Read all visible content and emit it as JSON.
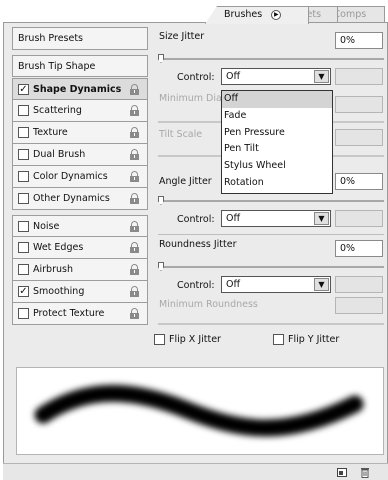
{
  "tabs": [
    {
      "label": "Brushes",
      "active": true
    },
    {
      "label": "Tool Presets",
      "active": false
    },
    {
      "label": "Layer Comps",
      "active": false
    }
  ],
  "tab_menu_icon": "circle-arrow-icon",
  "sidebar": {
    "brush_presets": "Brush Presets",
    "brush_tip_shape": "Brush Tip Shape",
    "items": [
      {
        "label": "Shape Dynamics",
        "checked": true,
        "selected": true
      },
      {
        "label": "Scattering",
        "checked": false
      },
      {
        "label": "Texture",
        "checked": false
      },
      {
        "label": "Dual Brush",
        "checked": false
      },
      {
        "label": "Color Dynamics",
        "checked": false
      },
      {
        "label": "Other Dynamics",
        "checked": false
      },
      {
        "label": "Noise",
        "checked": false
      },
      {
        "label": "Wet Edges",
        "checked": false
      },
      {
        "label": "Airbrush",
        "checked": false
      },
      {
        "label": "Smoothing",
        "checked": true
      },
      {
        "label": "Protect Texture",
        "checked": false
      }
    ],
    "check_mark": "✓",
    "lock_icon": "lock-icon"
  },
  "settings": {
    "size_jitter": {
      "label": "Size Jitter",
      "value": "0%",
      "slider_fraction": 0
    },
    "size_control": {
      "label": "Control:",
      "value": "Off"
    },
    "minimum_diameter": {
      "label": "Minimum Diameter",
      "visible_part": "Minimum Dia"
    },
    "tilt_scale": {
      "label": "Tilt Scale"
    },
    "angle_jitter": {
      "label": "Angle Jitter",
      "value": "0%",
      "slider_fraction": 0
    },
    "angle_control": {
      "label": "Control:",
      "value": "Off"
    },
    "roundness_jitter": {
      "label": "Roundness Jitter",
      "value": "0%",
      "slider_fraction": 0
    },
    "roundness_control": {
      "label": "Control:",
      "value": "Off"
    },
    "minimum_roundness": {
      "label": "Minimum Roundness"
    },
    "flip_x": {
      "label": "Flip X Jitter",
      "checked": false
    },
    "flip_y": {
      "label": "Flip Y Jitter",
      "checked": false
    }
  },
  "dropdown": {
    "open": true,
    "options": [
      "Off",
      "Fade",
      "Pen Pressure",
      "Pen Tilt",
      "Stylus Wheel",
      "Rotation"
    ],
    "highlighted": "Off"
  },
  "bottom_icons": [
    "new-brush-icon",
    "trash-icon"
  ],
  "colors": {
    "panel_bg": "#ebebeb",
    "selection": "#d4d4d4",
    "disabled_text": "#a8a8a8"
  }
}
